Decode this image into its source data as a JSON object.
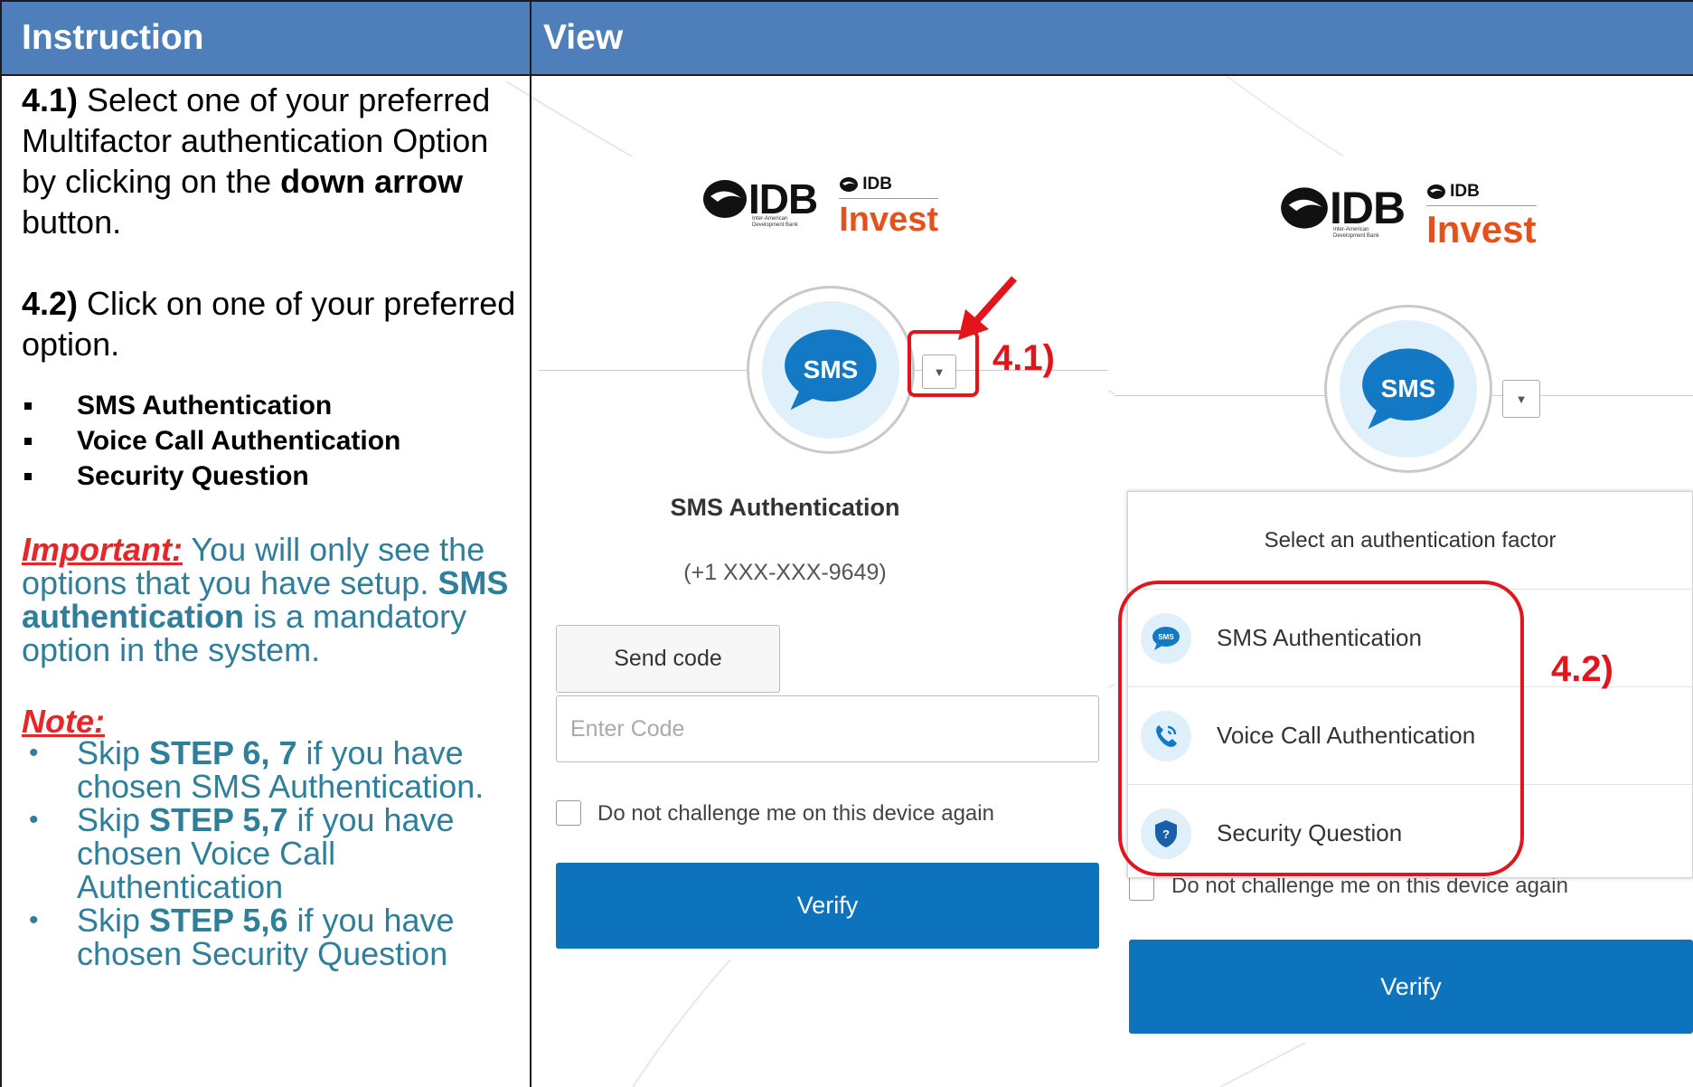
{
  "header": {
    "instruction_label": "Instruction",
    "view_label": "View",
    "background_color": "#4f7fba"
  },
  "instructions": {
    "step41_prefix": "4.1)",
    "step41_text_a": " Select one of your preferred Multifactor authentication Option by clicking on the ",
    "step41_bold": "down arrow",
    "step41_text_b": " button.",
    "step42_prefix": "4.2)",
    "step42_text": " Click on one of your preferred option.",
    "options": [
      "SMS Authentication",
      "Voice Call Authentication",
      "Security Question"
    ],
    "important_label": "Important:",
    "important_text_a": " You will only see the options that you have setup. ",
    "important_bold": "SMS authentication",
    "important_text_b": " is a mandatory option in the system.",
    "note_label": "Note:",
    "notes": [
      {
        "pre": "Skip ",
        "bold": "STEP 6, 7",
        "post": " if you have chosen SMS Authentication."
      },
      {
        "pre": "Skip ",
        "bold": "STEP 5,7",
        "post": " if you have chosen Voice Call Authentication"
      },
      {
        "pre": "Skip ",
        "bold": "STEP 5,6",
        "post": " if you have chosen Security Question"
      }
    ],
    "accent_color": "#2f7f9b"
  },
  "logo": {
    "idb": "IDB",
    "idb_sub_1": "Inter-American",
    "idb_sub_2": "Development Bank",
    "idb_small": "IDB",
    "invest": "Invest"
  },
  "panel_left": {
    "badge": "SMS",
    "dropdown_icon": "triangle-down-icon",
    "factor_title": "SMS Authentication",
    "phone": "(+1 XXX-XXX-9649)",
    "send_code": "Send code",
    "code_placeholder": "Enter Code",
    "remember_label": "Do not challenge me on this device again",
    "verify": "Verify"
  },
  "panel_right": {
    "badge": "SMS",
    "menu_title": "Select an authentication factor",
    "menu_items": [
      {
        "label": "SMS Authentication",
        "icon": "sms-icon"
      },
      {
        "label": "Voice Call Authentication",
        "icon": "phone-call-icon"
      },
      {
        "label": "Security Question",
        "icon": "shield-question-icon"
      }
    ],
    "remember_label": "Do not challenge me on this device again",
    "verify": "Verify"
  },
  "annotations": {
    "step41": "4.1)",
    "step42": "4.2)",
    "color": "#e3141b"
  }
}
